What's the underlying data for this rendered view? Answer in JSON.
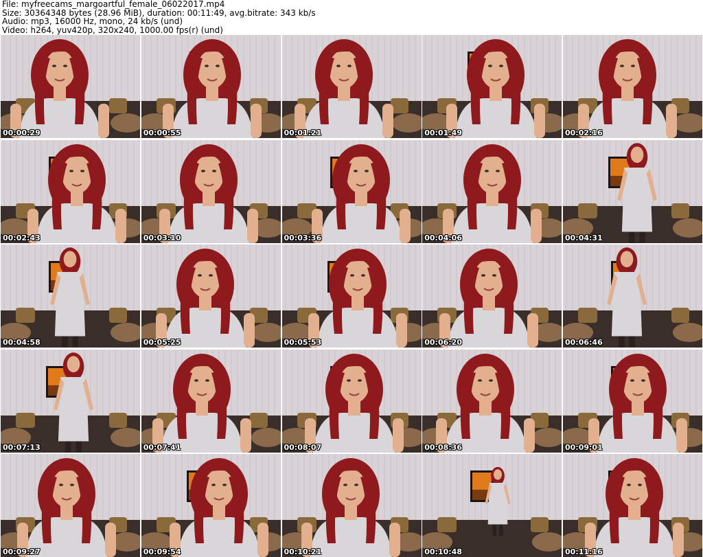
{
  "header": {
    "file": "File: myfreecams_margoartful_female_06022017.mp4",
    "size": "Size: 30364348 bytes (28.96 MiB), duration: 00:11:49, avg.bitrate: 343 kb/s",
    "audio": "Audio: mp3, 16000 Hz, mono, 24 kb/s (und)",
    "video": "Video: h264, yuv420p, 320x240, 1000.00 fps(r) (und)"
  },
  "frames": [
    {
      "time": "00:00:29",
      "pose": "closeup"
    },
    {
      "time": "00:00:55",
      "pose": "closeup"
    },
    {
      "time": "00:01:21",
      "pose": "closeup"
    },
    {
      "time": "00:01:49",
      "pose": "closeup"
    },
    {
      "time": "00:02:16",
      "pose": "closeup"
    },
    {
      "time": "00:02:43",
      "pose": "closeup"
    },
    {
      "time": "00:03:10",
      "pose": "closeup"
    },
    {
      "time": "00:03:36",
      "pose": "closeup"
    },
    {
      "time": "00:04:06",
      "pose": "closeup"
    },
    {
      "time": "00:04:31",
      "pose": "standing"
    },
    {
      "time": "00:04:58",
      "pose": "standing"
    },
    {
      "time": "00:05:25",
      "pose": "closeup"
    },
    {
      "time": "00:05:53",
      "pose": "closeup"
    },
    {
      "time": "00:06:20",
      "pose": "closeup"
    },
    {
      "time": "00:06:46",
      "pose": "standing"
    },
    {
      "time": "00:07:13",
      "pose": "standing"
    },
    {
      "time": "00:07:41",
      "pose": "closeup"
    },
    {
      "time": "00:08:07",
      "pose": "closeup"
    },
    {
      "time": "00:08:36",
      "pose": "closeup"
    },
    {
      "time": "00:09:01",
      "pose": "closeup"
    },
    {
      "time": "00:09:27",
      "pose": "closeup"
    },
    {
      "time": "00:09:54",
      "pose": "closeup"
    },
    {
      "time": "00:10:21",
      "pose": "closeup"
    },
    {
      "time": "00:10:48",
      "pose": "standing-far"
    },
    {
      "time": "00:11:16",
      "pose": "closeup"
    }
  ],
  "colors": {
    "wall": "#d9d3d8",
    "hair": "#8e1a1e",
    "skin": "#e2b08f",
    "dress": "#d8d6d8",
    "sofa": "#3a2e2a",
    "cushion": "#8a6a3a",
    "frame": "#e07a1a",
    "timestamp": "#ffffff"
  }
}
